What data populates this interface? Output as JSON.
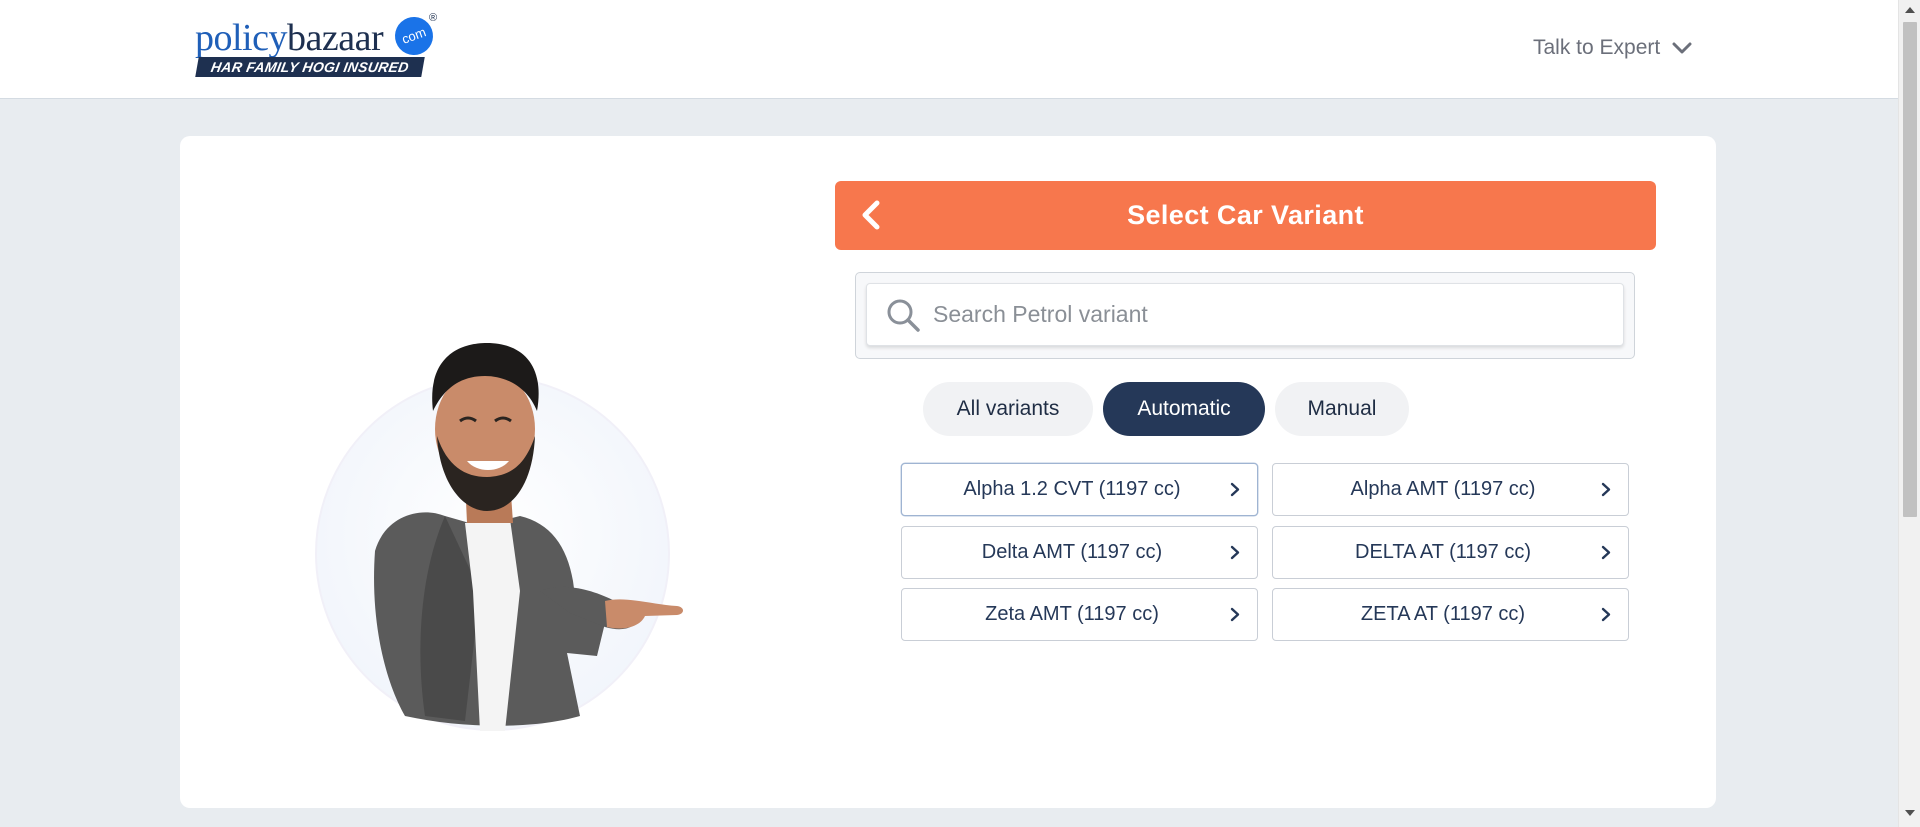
{
  "header": {
    "logo": {
      "word_policy": "policy",
      "word_bazaar": "bazaar",
      "badge": "com",
      "registered": "®",
      "tagline": "HAR FAMILY HOGI INSURED"
    },
    "talk_to_expert": "Talk to Expert"
  },
  "panel": {
    "title": "Select Car Variant",
    "search": {
      "placeholder": "Search Petrol variant",
      "value": ""
    },
    "filters": [
      {
        "label": "All variants",
        "active": false
      },
      {
        "label": "Automatic",
        "active": true
      },
      {
        "label": "Manual",
        "active": false
      }
    ],
    "variants": [
      "Alpha 1.2 CVT (1197 cc)",
      "Alpha AMT (1197 cc)",
      "Delta AMT (1197 cc)",
      "DELTA AT (1197 cc)",
      "Zeta AMT (1197 cc)",
      "ZETA AT (1197 cc)"
    ]
  },
  "colors": {
    "accent_orange": "#f7774d",
    "navy": "#253858",
    "brand_blue": "#1a73e8"
  },
  "icons": {
    "back": "chevron-left-icon",
    "search": "search-icon",
    "dropdown": "chevron-down-icon",
    "variant_arrow": "chevron-right-icon"
  }
}
